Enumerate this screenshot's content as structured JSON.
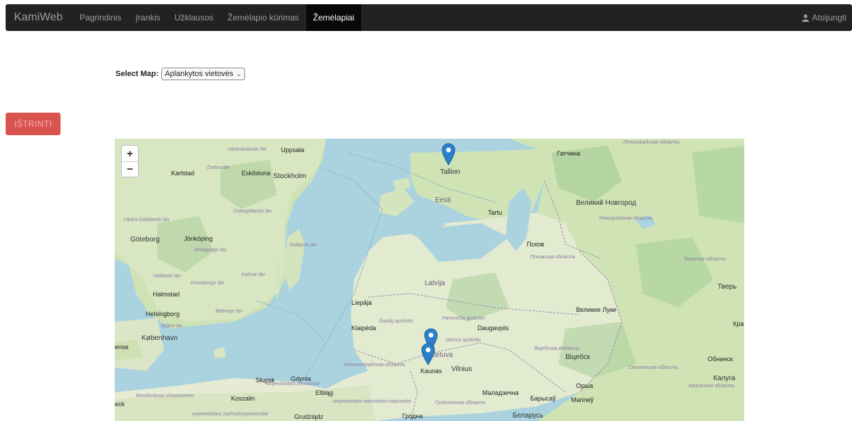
{
  "navbar": {
    "brand": "KamiWeb",
    "items": [
      {
        "label": "Pagrindinis"
      },
      {
        "label": "Įrankis"
      },
      {
        "label": "Užklausos"
      },
      {
        "label": "Žemėlapio kūrimas"
      },
      {
        "label": "Žemėlapiai"
      }
    ],
    "active_index": 4,
    "logout_label": "Atsijungti"
  },
  "map_select": {
    "label": "Select Map:",
    "selected": "Aplankytos vietovės"
  },
  "delete_button": {
    "label": "IŠTRINTI",
    "color": "#d9534f"
  },
  "map": {
    "zoom_in": "+",
    "zoom_out": "−",
    "labels": {
      "uppsala": "Uppsala",
      "karlstad": "Karlstad",
      "eskilstuna": "Eskilstuna",
      "stockholm": "Stockholm",
      "goteborg": "Göteborg",
      "jonkoping": "Jönköping",
      "halmstad": "Halmstad",
      "helsingborg": "Helsingborg",
      "kobenhavn": "København",
      "koszalin": "Koszalin",
      "slupsk": "Słupsk",
      "gdynia": "Gdynia",
      "elblag": "Elbląg",
      "tallinn": "Tallinn",
      "eesti": "Eesti",
      "tartu": "Tartu",
      "latvija": "Latvija",
      "liepaja": "Liepāja",
      "klaipeda": "Klaipėda",
      "daugavpils": "Daugavpils",
      "kaunas": "Kaunas",
      "vilnius": "Vilnius",
      "lietuva": "Lietuva",
      "pskov": "Псков",
      "novgorod": "Великий Новгород",
      "gatchina": "Гатчина",
      "tver": "Тверь",
      "vitebsk": "Віцебск",
      "hrodna": "Гродна",
      "maladzechna": "Маладзечна",
      "barysau": "Барысаў",
      "marina": "Marineў",
      "belarus": "Беларусь",
      "orsha": "Орша",
      "kaluga": "Калуга",
      "obninsk": "Обнинск",
      "velikie_luki": "Великие Луки",
      "gotlands": "Gotlands län",
      "kalmar": "Kalmar län",
      "kronobergs": "Kronobergs län",
      "hallands": "Hallands län",
      "blekinge": "Blekinge län",
      "skane": "Skåne län",
      "ostergotlands": "Östergötlands län",
      "vastra": "Västra Götalands län",
      "jonkopings": "Jönköpings län",
      "vastmanlands": "Västmanlands län",
      "orebro": "Örebro län",
      "kaliningrad": "Калининградская область",
      "siauliai": "Šiaulių apskritis",
      "panevezys": "Panevėžio apskritis",
      "utena": "Utenos apskritis",
      "mecklenburg": "Mecklenburg-Vorpommern",
      "pomorskie": "województwo pomorskie",
      "warminsko": "województwo warmińsko-mazurskie",
      "zachodnio": "województwo zachodniopomorskie",
      "grodno_obl": "Гродненская область",
      "vitebsk_obl": "Віцебская вобласць",
      "pskov_obl": "Псковская область",
      "novgorod_obl": "Новгородская область",
      "leningrad_obl": "Ленинградская область",
      "tver_obl": "Тверская область",
      "smolensk_obl": "Смоленская область",
      "kaluga_obl": "Калужская область",
      "kra": "Кра",
      "ense": "ense",
      "eck": "eck",
      "grudziadz": "Grudziądz"
    },
    "markers": [
      {
        "name": "Tallinn"
      },
      {
        "name": "Lithuania-north"
      },
      {
        "name": "Kaunas"
      }
    ],
    "colors": {
      "water": "#aad3df",
      "land": "#e8ecd8",
      "forest": "#add19e",
      "border": "#9e86b2"
    }
  }
}
